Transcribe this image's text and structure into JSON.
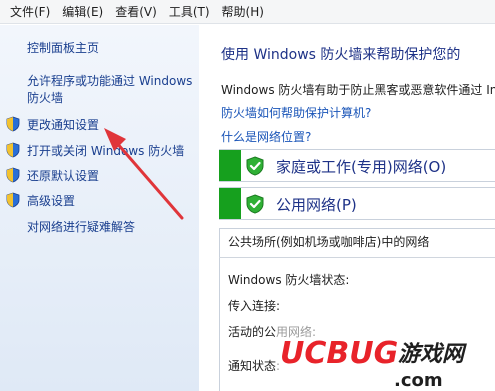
{
  "menubar": {
    "items": [
      "文件(F)",
      "编辑(E)",
      "查看(V)",
      "工具(T)",
      "帮助(H)"
    ]
  },
  "nav": {
    "home": "控制面板主页",
    "allow_programs": "允许程序或功能通过 Windows 防火墙",
    "change_notify": "更改通知设置",
    "toggle_firewall": "打开或关闭 Windows 防火墙",
    "restore_defaults": "还原默认设置",
    "advanced": "高级设置",
    "troubleshoot": "对网络进行疑难解答"
  },
  "content": {
    "title": "使用 Windows 防火墙来帮助保护您的",
    "description": "Windows 防火墙有助于防止黑客或恶意软件通过 In",
    "link_help": "防火墙如何帮助保护计算机?",
    "link_location": "什么是网络位置?",
    "network_home": "家庭或工作(专用)网络(O)",
    "network_public": "公用网络(P)",
    "public_desc": "公共场所(例如机场或咖啡店)中的网络",
    "status_label": "Windows 防火墙状态:",
    "incoming_label": "传入连接:",
    "active_label": "活动的公用网络:",
    "notify_label": "通知状态:"
  },
  "watermark": {
    "brand": "UCBUG",
    "suffix": "游戏网",
    "domain": ".com"
  },
  "colors": {
    "nav_link": "#1a3f8f",
    "status_green": "#16a01e",
    "arrow_red": "#e0353a",
    "title_blue": "#1e3287"
  }
}
